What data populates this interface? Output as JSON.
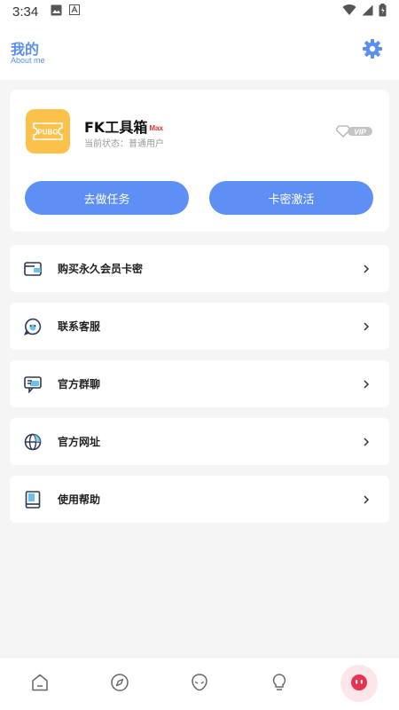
{
  "status_bar": {
    "time": "3:34",
    "icons": [
      "image-icon",
      "a-icon",
      "wifi-icon",
      "signal-icon",
      "battery-icon"
    ]
  },
  "header": {
    "title": "我的",
    "subtitle": "About me",
    "settings_icon": "gear-icon",
    "accent_color": "#5b8ef0"
  },
  "profile": {
    "logo_text": "PUBG",
    "app_name": "FK工具箱",
    "edition": "Max",
    "status": "当前状态：普通用户",
    "vip_label": "VIP",
    "buttons": {
      "task": "去做任务",
      "activate": "卡密激活"
    }
  },
  "menu": [
    {
      "label": "购买永久会员卡密",
      "icon": "wallet-icon"
    },
    {
      "label": "联系客服",
      "icon": "chat-bubble-icon"
    },
    {
      "label": "官方群聊",
      "icon": "group-chat-icon"
    },
    {
      "label": "官方网址",
      "icon": "globe-icon"
    },
    {
      "label": "使用帮助",
      "icon": "book-icon"
    }
  ],
  "bottom_nav": [
    {
      "icon": "home-icon",
      "active": false
    },
    {
      "icon": "compass-icon",
      "active": false
    },
    {
      "icon": "alien-icon",
      "active": false
    },
    {
      "icon": "lightbulb-icon",
      "active": false
    },
    {
      "icon": "profile-face-icon",
      "active": true
    }
  ],
  "colors": {
    "primary_button": "#5e8ff4",
    "logo_bg": "#fcc14a",
    "max_badge": "#e0302a",
    "active_nav": "#e8334f"
  }
}
